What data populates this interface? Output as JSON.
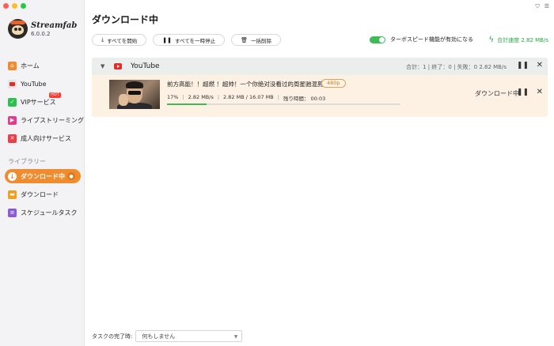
{
  "app": {
    "name": "Streamfab",
    "version": "6.0.0.2"
  },
  "sidebar": {
    "items": [
      {
        "label": "ホーム",
        "icon": "home-icon"
      },
      {
        "label": "YouTube",
        "icon": "youtube-icon"
      },
      {
        "label": "VIPサービス",
        "icon": "vip-icon",
        "badge": "HOT"
      },
      {
        "label": "ライブストリーミング",
        "icon": "live-icon"
      },
      {
        "label": "成人向けサービス",
        "icon": "adult-icon"
      }
    ],
    "library_label": "ライブラリー",
    "library_items": [
      {
        "label": "ダウンロード中",
        "icon": "downloading-icon",
        "active": true
      },
      {
        "label": "ダウンロード",
        "icon": "download-folder-icon"
      },
      {
        "label": "スケジュールタスク",
        "icon": "schedule-icon"
      }
    ]
  },
  "main": {
    "title": "ダウンロード中",
    "toolbar": {
      "start_all": "すべてを開始",
      "pause_all": "すべてを一時停止",
      "delete_all": "一括削除"
    },
    "turbo_label": "ターボスピード機能が有効になる",
    "total_speed": "合計速度 2.82 MB/s",
    "group": {
      "name": "YouTube",
      "stats": "合計：1  |  終了：0  |  失敗：0     2.82 MB/s"
    },
    "item": {
      "title": "前方高能！！超燃 ！超帅！一个你绝对没看过的周星驰混剪",
      "quality": "480p",
      "percent": "17%",
      "speed": "2.82 MB/s",
      "size": "2.82 MB / 16.07 MB",
      "remaining": "残り時間： 00:03",
      "progress": 0.17,
      "status": "ダウンロード中"
    },
    "footer": {
      "label": "タスクの完了時:",
      "select_value": "何もしません"
    }
  },
  "colors": {
    "accent": "#f08b2e",
    "green": "#3dbb55",
    "item_bg": "#fdf1e4"
  }
}
